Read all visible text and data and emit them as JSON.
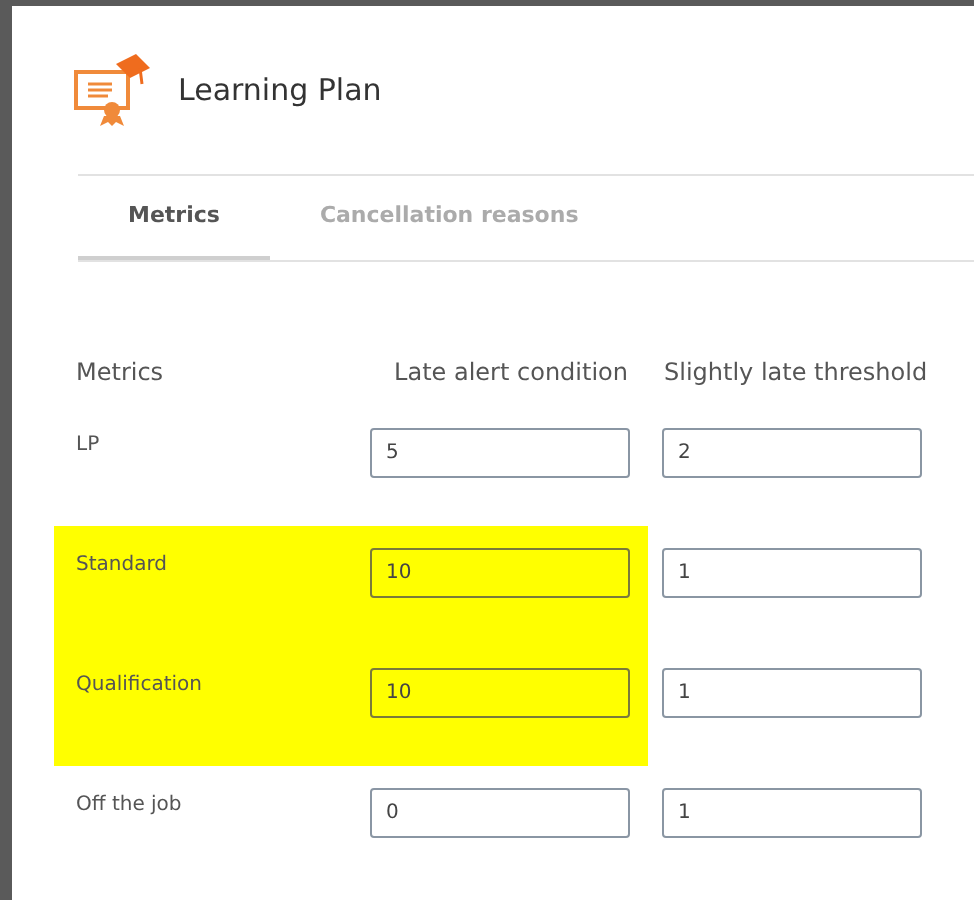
{
  "dialog": {
    "title": "Learning Plan"
  },
  "tabs": [
    {
      "label": "Metrics",
      "selected": true
    },
    {
      "label": "Cancellation reasons",
      "selected": false
    }
  ],
  "table": {
    "columns": [
      "Metrics",
      "Late alert condition",
      "Slightly late threshold"
    ],
    "rows": [
      {
        "metric": "LP",
        "late_alert_condition": "5",
        "slightly_late_threshold": "2",
        "highlighted": false
      },
      {
        "metric": "Standard",
        "late_alert_condition": "10",
        "slightly_late_threshold": "1",
        "highlighted": true
      },
      {
        "metric": "Qualification",
        "late_alert_condition": "10",
        "slightly_late_threshold": "1",
        "highlighted": true
      },
      {
        "metric": "Off the job",
        "late_alert_condition": "0",
        "slightly_late_threshold": "1",
        "highlighted": false
      }
    ]
  }
}
